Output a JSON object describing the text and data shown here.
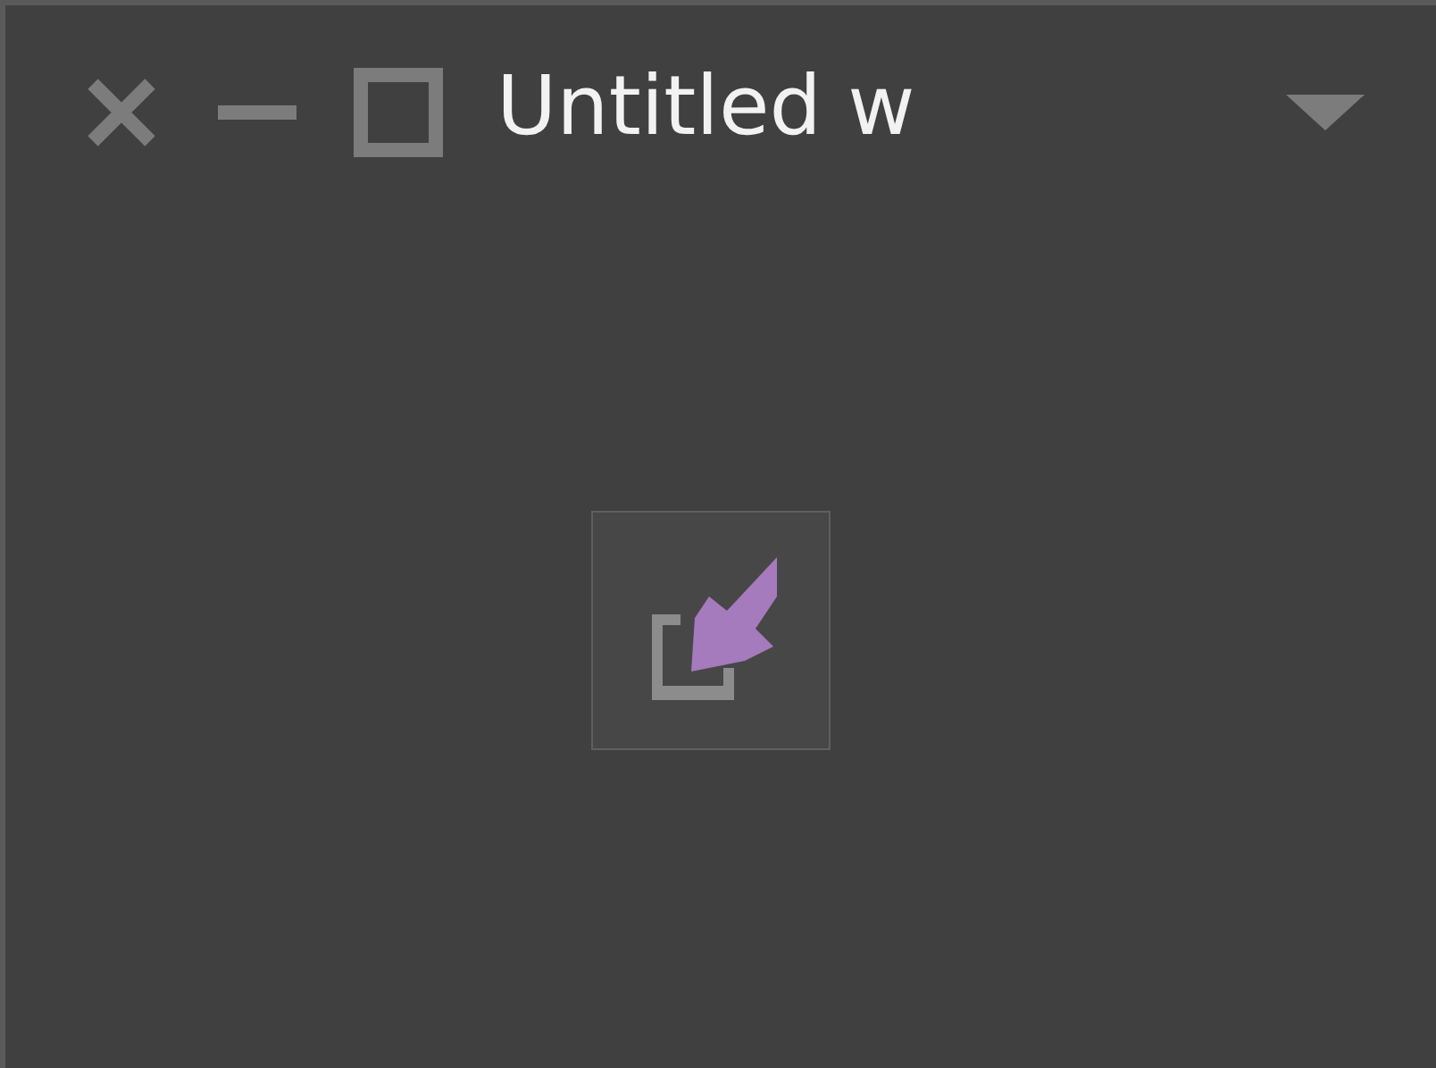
{
  "window": {
    "title": "Untitled w"
  }
}
